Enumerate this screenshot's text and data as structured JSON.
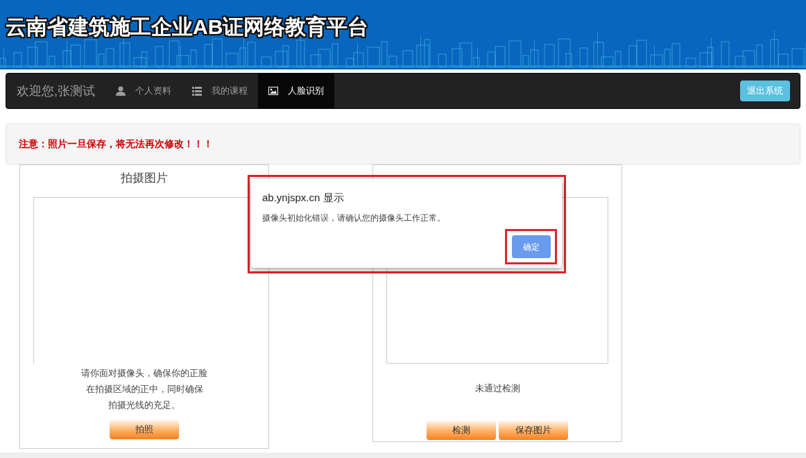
{
  "header": {
    "title": "云南省建筑施工企业AB证网络教育平台"
  },
  "navbar": {
    "welcome": "欢迎您,张测试",
    "items": [
      {
        "label": "个人资料",
        "selected": false
      },
      {
        "label": "我的课程",
        "selected": false
      },
      {
        "label": "人脸识别",
        "selected": true
      }
    ],
    "logout": "退出系统"
  },
  "notice": "注意：照片一旦保存，将无法再次修改！！！",
  "capture_panel": {
    "title": "拍摄图片",
    "instructions": [
      "请你面对摄像头，确保你的正脸",
      "在拍摄区域的正中，同时确保",
      "拍摄光线的充足。"
    ],
    "buttons": [
      "拍照"
    ]
  },
  "preview_panel": {
    "status": "未通过检测",
    "buttons": [
      "检测",
      "保存图片"
    ]
  },
  "dialog": {
    "title": "ab.ynjspx.cn 显示",
    "message": "摄像头初始化错误，请确认您的摄像头工作正常。",
    "button": "确定"
  }
}
